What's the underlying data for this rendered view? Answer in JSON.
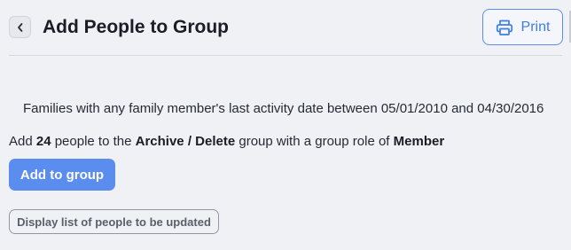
{
  "header": {
    "title": "Add People to Group",
    "back_icon": "chevron-left-icon",
    "print_label": "Print",
    "print_icon": "printer-icon"
  },
  "filter": {
    "description": "Families with any family member's last activity date between 05/01/2010 and 04/30/2016"
  },
  "summary": {
    "prefix": "Add ",
    "count": "24",
    "middle": " people to the ",
    "group_name": "Archive / Delete",
    "role_text": " group with a group role of ",
    "role": "Member"
  },
  "actions": {
    "add_label": "Add to group",
    "display_list_label": "Display list of people to be updated"
  },
  "colors": {
    "accent": "#5b8def",
    "background": "#f0f1f4",
    "text": "#1f2330"
  }
}
